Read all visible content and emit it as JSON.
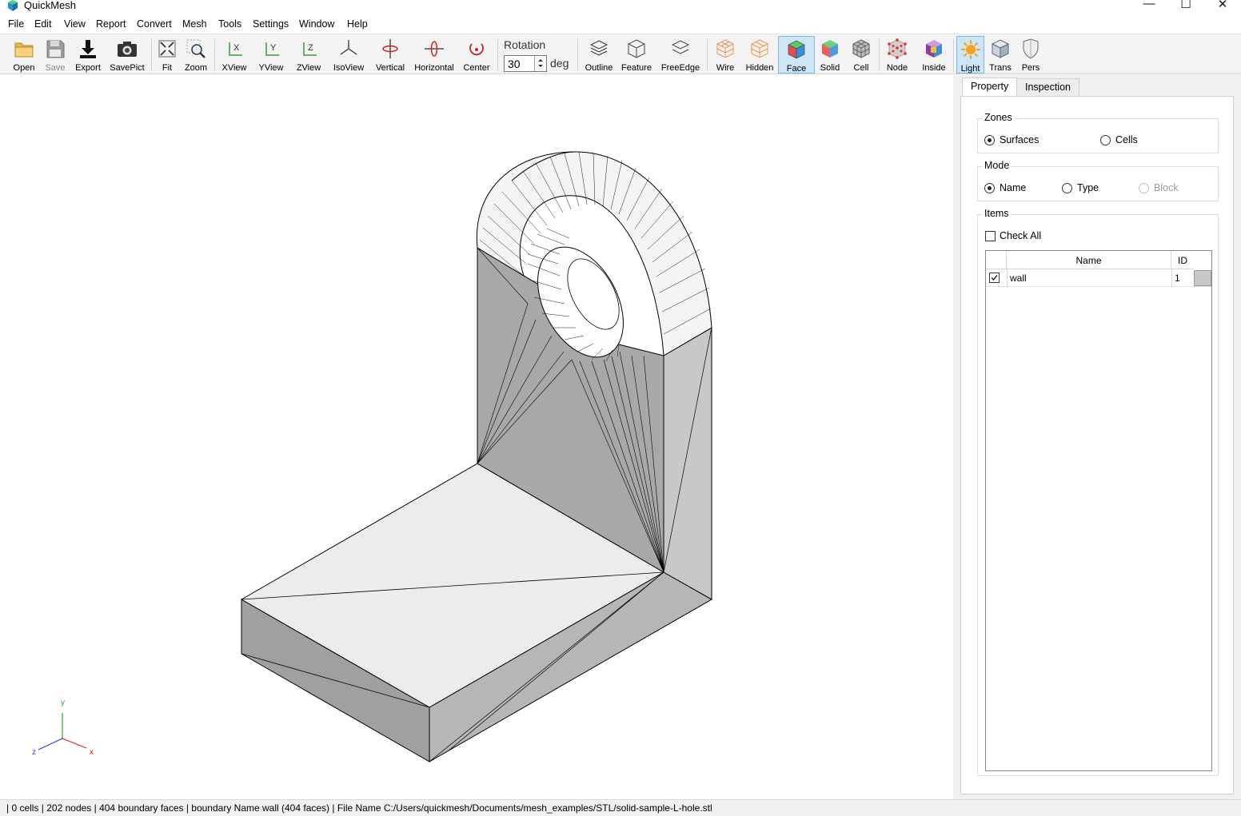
{
  "window": {
    "title": "QuickMesh",
    "minimize": "—",
    "maximize": "☐",
    "close": "✕"
  },
  "menu": [
    "File",
    "Edit",
    "View",
    "Report",
    "Convert",
    "Mesh",
    "Tools",
    "Settings",
    "Window",
    "Help"
  ],
  "toolbar": {
    "open": "Open",
    "save": "Save",
    "export": "Export",
    "savepict": "SavePict",
    "fit": "Fit",
    "zoom": "Zoom",
    "xview": "XView",
    "yview": "YView",
    "zview": "ZView",
    "isoview": "IsoView",
    "vertical": "Vertical",
    "horizontal": "Horizontal",
    "center": "Center",
    "rotation_label": "Rotation",
    "rotation_value": "30",
    "rotation_unit": "deg",
    "outline": "Outline",
    "feature": "Feature",
    "freeedge": "FreeEdge",
    "wire": "Wire",
    "hidden": "Hidden",
    "face": "Face",
    "solid": "Solid",
    "cell": "Cell",
    "node": "Node",
    "inside": "Inside",
    "light": "Light",
    "trans": "Trans",
    "pers": "Pers"
  },
  "axes": {
    "x": "x",
    "y": "y",
    "z": "z"
  },
  "panel": {
    "tabs": [
      "Property",
      "Inspection"
    ],
    "zones": {
      "title": "Zones",
      "options": [
        "Surfaces",
        "Cells"
      ],
      "selected": "Surfaces"
    },
    "mode": {
      "title": "Mode",
      "options": [
        "Name",
        "Type",
        "Block"
      ],
      "selected": "Name"
    },
    "items": {
      "title": "Items",
      "check_all": "Check All",
      "columns": [
        "Name",
        "ID"
      ],
      "rows": [
        {
          "checked": true,
          "name": "wall",
          "id": "1"
        }
      ]
    }
  },
  "status": "| 0 cells | 202 nodes | 404 boundary faces |  boundary Name wall (404 faces) | File Name C:/Users/quickmesh/Documents/mesh_examples/STL/solid-sample-L-hole.stl"
}
